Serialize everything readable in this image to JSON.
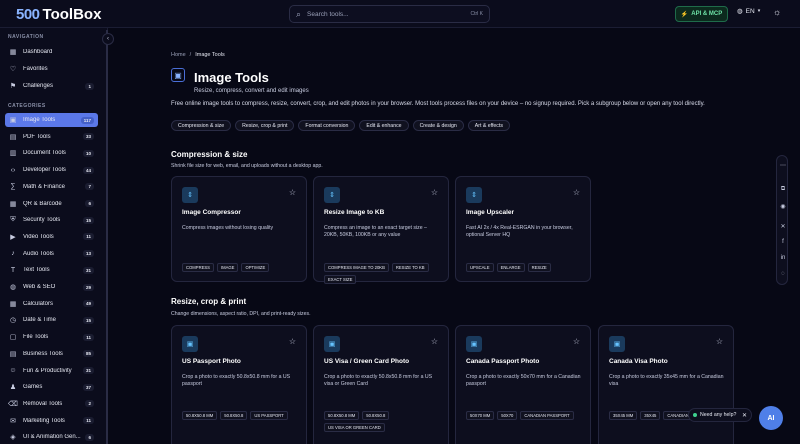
{
  "header": {
    "logo_num": "500",
    "logo_text": "ToolBox",
    "search_placeholder": "Search tools...",
    "search_shortcut": "Ctrl K",
    "api_label": "API & MCP",
    "lang_label": "EN"
  },
  "sidebar": {
    "nav_heading": "NAVIGATION",
    "nav": [
      {
        "label": "Dashboard",
        "count": ""
      },
      {
        "label": "Favorites",
        "count": ""
      },
      {
        "label": "Challenges",
        "count": "1"
      }
    ],
    "cat_heading": "CATEGORIES",
    "categories": [
      {
        "label": "Image Tools",
        "count": "117"
      },
      {
        "label": "PDF Tools",
        "count": "33"
      },
      {
        "label": "Document Tools",
        "count": "10"
      },
      {
        "label": "Developer Tools",
        "count": "44"
      },
      {
        "label": "Math & Finance",
        "count": "7"
      },
      {
        "label": "QR & Barcode",
        "count": "6"
      },
      {
        "label": "Security Tools",
        "count": "15"
      },
      {
        "label": "Video Tools",
        "count": "11"
      },
      {
        "label": "Audio Tools",
        "count": "13"
      },
      {
        "label": "Text Tools",
        "count": "31"
      },
      {
        "label": "Web & SEO",
        "count": "29"
      },
      {
        "label": "Calculators",
        "count": "49"
      },
      {
        "label": "Date & Time",
        "count": "15"
      },
      {
        "label": "File Tools",
        "count": "11"
      },
      {
        "label": "Business Tools",
        "count": "85"
      },
      {
        "label": "Fun & Productivity",
        "count": "31"
      },
      {
        "label": "Games",
        "count": "37"
      },
      {
        "label": "Removal Tools",
        "count": "2"
      },
      {
        "label": "Marketing Tools",
        "count": "11"
      },
      {
        "label": "UI & Animation Gen...",
        "count": "6"
      }
    ]
  },
  "breadcrumb": {
    "home": "Home",
    "sep": "/",
    "current": "Image Tools"
  },
  "page": {
    "title": "Image Tools",
    "subtitle": "Resize, compress, convert and edit images",
    "description": "Free online image tools to compress, resize, convert, crop, and edit photos in your browser. Most tools process files on your device – no signup required. Pick a subgroup below or open any tool directly.",
    "chips": [
      "Compression & size",
      "Resize, crop & print",
      "Format conversion",
      "Edit & enhance",
      "Create & design",
      "Art & effects"
    ]
  },
  "sections": [
    {
      "title": "Compression & size",
      "subtitle": "Shrink file size for web, email, and uploads without a desktop app.",
      "cards": [
        {
          "title": "Image Compressor",
          "desc": "Compress images without losing quality",
          "tags": [
            "COMPRESS",
            "IMAGE",
            "OPTIMIZE"
          ]
        },
        {
          "title": "Resize Image to KB",
          "desc": "Compress an image to an exact target size – 20KB, 50KB, 100KB or any value",
          "tags": [
            "COMPRESS IMAGE TO 20KB",
            "RESIZE TO KB",
            "EXACT SIZE"
          ]
        },
        {
          "title": "Image Upscaler",
          "desc": "Fast AI 2x / 4x Real-ESRGAN in your browser, optional Server HQ",
          "tags": [
            "UPSCALE",
            "ENLARGE",
            "RESIZE"
          ]
        }
      ]
    },
    {
      "title": "Resize, crop & print",
      "subtitle": "Change dimensions, aspect ratio, DPI, and print-ready sizes.",
      "cards": [
        {
          "title": "US Passport Photo",
          "desc": "Crop a photo to exactly 50.8x50.8 mm for a US passport",
          "tags": [
            "50.8X50.8 MM",
            "50.8X50.8",
            "US PASSPORT"
          ]
        },
        {
          "title": "US Visa / Green Card Photo",
          "desc": "Crop a photo to exactly 50.8x50.8 mm for a US visa or Green Card",
          "tags": [
            "50.8X50.8 MM",
            "50.8X50.8",
            "US VISA OR GREEN CARD"
          ]
        },
        {
          "title": "Canada Passport Photo",
          "desc": "Crop a photo to exactly 50x70 mm for a Canadian passport",
          "tags": [
            "50X70 MM",
            "50X70",
            "CANADIAN PASSPORT"
          ]
        },
        {
          "title": "Canada Visa Photo",
          "desc": "Crop a photo to exactly 35x45 mm for a Canadian visa",
          "tags": [
            "35X45 MM",
            "35X45",
            "CANADIAN"
          ]
        }
      ]
    }
  ],
  "help": {
    "label": "Need any help?",
    "ai_label": "AI"
  }
}
